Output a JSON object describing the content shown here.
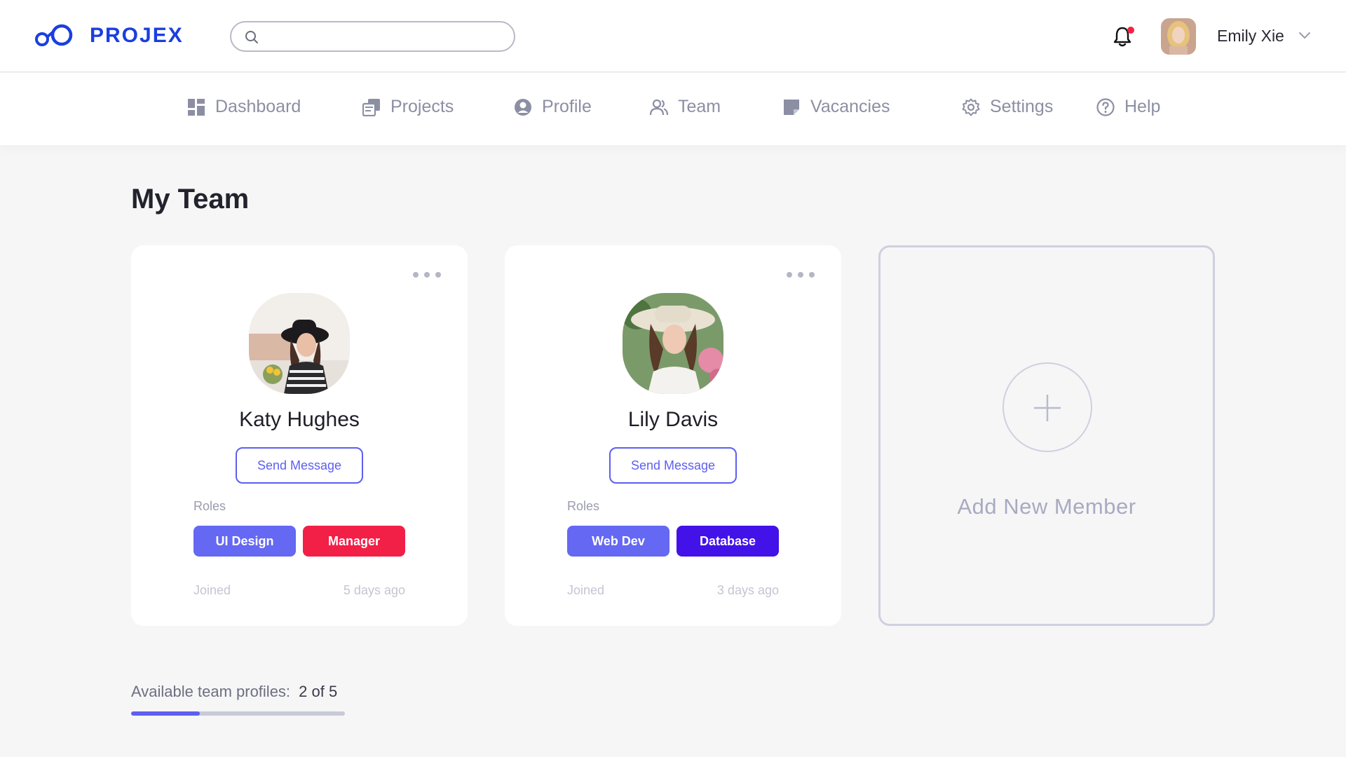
{
  "header": {
    "brand": "PROJEX",
    "search_placeholder": "",
    "user_name": "Emily Xie",
    "notifications_unread": true
  },
  "nav": {
    "items": [
      {
        "label": "Dashboard",
        "icon": "dashboard-icon"
      },
      {
        "label": "Projects",
        "icon": "projects-icon"
      },
      {
        "label": "Profile",
        "icon": "profile-icon"
      },
      {
        "label": "Team",
        "icon": "team-icon"
      },
      {
        "label": "Vacancies",
        "icon": "vacancies-icon"
      },
      {
        "label": "Settings",
        "icon": "settings-icon"
      },
      {
        "label": "Help",
        "icon": "help-icon"
      }
    ]
  },
  "page": {
    "title": "My Team"
  },
  "members": [
    {
      "name": "Katy Hughes",
      "send_label": "Send Message",
      "roles_label": "Roles",
      "roles": [
        {
          "label": "UI Design",
          "color": "#6468f2"
        },
        {
          "label": "Manager",
          "color": "#f21f47"
        }
      ],
      "joined_label": "Joined",
      "joined_value": "5 days ago"
    },
    {
      "name": "Lily Davis",
      "send_label": "Send Message",
      "roles_label": "Roles",
      "roles": [
        {
          "label": "Web Dev",
          "color": "#6468f2"
        },
        {
          "label": "Database",
          "color": "#4312e8"
        }
      ],
      "joined_label": "Joined",
      "joined_value": "3 days ago"
    }
  ],
  "add_member": {
    "label": "Add New Member"
  },
  "footer": {
    "profiles_label": "Available team profiles:",
    "profiles_count": "2 of 5",
    "profiles_fraction": 0.32
  },
  "colors": {
    "brand": "#1a3fe0",
    "accent": "#5d5fef",
    "notification": "#ef2444"
  }
}
